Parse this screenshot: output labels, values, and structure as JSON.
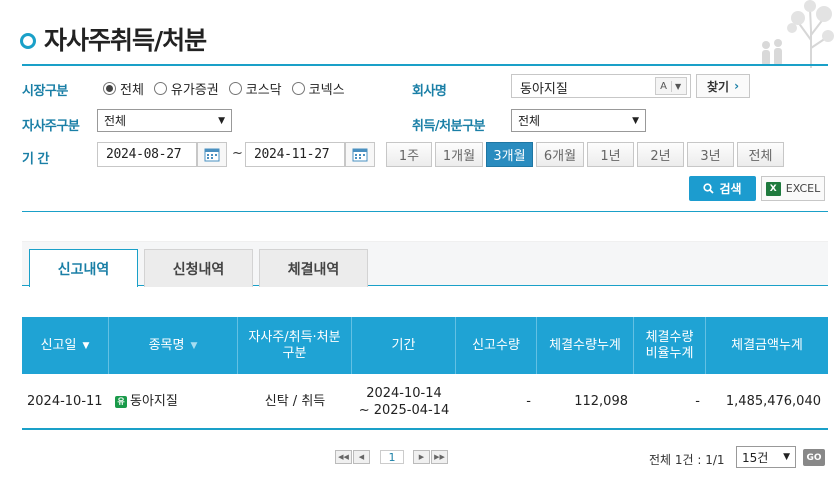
{
  "page": {
    "title": "자사주취득/처분"
  },
  "filters": {
    "market_label": "시장구분",
    "market_options": [
      {
        "label": "전체",
        "checked": true
      },
      {
        "label": "유가증권",
        "checked": false
      },
      {
        "label": "코스닥",
        "checked": false
      },
      {
        "label": "코넥스",
        "checked": false
      }
    ],
    "company_label": "회사명",
    "company_value": "동아지질",
    "autocomplete_label": "A",
    "find_label": "찾기",
    "treasury_label": "자사주구분",
    "treasury_value": "전체",
    "action_label": "취득/처분구분",
    "action_value": "전체",
    "period_label": "기 간",
    "start_date": "2024-08-27",
    "end_date": "2024-11-27",
    "tilde": "~",
    "period_buttons": [
      {
        "label": "1주",
        "active": false
      },
      {
        "label": "1개월",
        "active": false
      },
      {
        "label": "3개월",
        "active": true
      },
      {
        "label": "6개월",
        "active": false
      },
      {
        "label": "1년",
        "active": false
      },
      {
        "label": "2년",
        "active": false
      },
      {
        "label": "3년",
        "active": false
      },
      {
        "label": "전체",
        "active": false
      }
    ],
    "search_label": "검색",
    "excel_label": "EXCEL"
  },
  "tabs": [
    {
      "label": "신고내역",
      "active": true
    },
    {
      "label": "신청내역",
      "active": false
    },
    {
      "label": "체결내역",
      "active": false
    }
  ],
  "table": {
    "headers": {
      "report_date": "신고일",
      "stock_name": "종목명",
      "type_a": "자사주/취득·처분",
      "type_b": "구분",
      "period": "기간",
      "report_qty": "신고수량",
      "exec_qty": "체결수량누계",
      "ratio_a": "체결수량",
      "ratio_b": "비율누계",
      "exec_amount": "체결금액누계"
    },
    "rows": [
      {
        "report_date": "2024-10-11",
        "market_badge": "유",
        "stock_name": "동아지질",
        "type": "신탁 / 취득",
        "period_start": "2024-10-14",
        "period_end": "~ 2025-04-14",
        "report_qty": "-",
        "exec_qty": "112,098",
        "ratio": "-",
        "exec_amount": "1,485,476,040"
      }
    ]
  },
  "pagination": {
    "current_page": "1",
    "total_text": "전체 1건 : 1/1",
    "page_size": "15건",
    "go_label": "GO"
  }
}
